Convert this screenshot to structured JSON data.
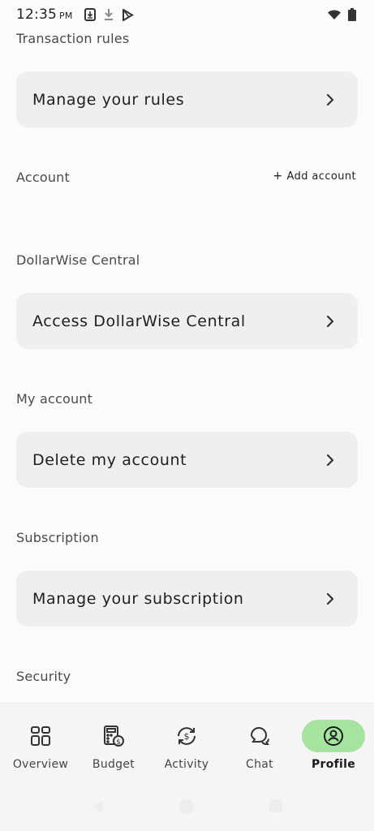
{
  "status_bar": {
    "time": "12:35",
    "ampm": "PM",
    "icons": [
      "download-box-icon",
      "download-icon",
      "play-store-icon",
      "wifi-icon",
      "battery-icon"
    ]
  },
  "sections": {
    "transaction_rules": {
      "title": "Transaction rules",
      "card_label": "Manage your rules"
    },
    "account": {
      "title": "Account",
      "add_label": "Add account",
      "add_prefix": "+"
    },
    "central": {
      "title": "DollarWise Central",
      "card_label": "Access DollarWise Central"
    },
    "my_account": {
      "title": "My account",
      "card_label": "Delete my account"
    },
    "subscription": {
      "title": "Subscription",
      "card_label": "Manage your subscription"
    },
    "security": {
      "title": "Security"
    }
  },
  "bottom_nav": {
    "items": [
      {
        "label": "Overview",
        "icon": "grid-icon"
      },
      {
        "label": "Budget",
        "icon": "budget-calculator-icon"
      },
      {
        "label": "Activity",
        "icon": "activity-dollar-icon"
      },
      {
        "label": "Chat",
        "icon": "chat-icon"
      },
      {
        "label": "Profile",
        "icon": "profile-icon",
        "active": true
      }
    ]
  },
  "colors": {
    "background": "#fbfbfb",
    "card": "#efefef",
    "active_pill": "#a6e3a1"
  }
}
